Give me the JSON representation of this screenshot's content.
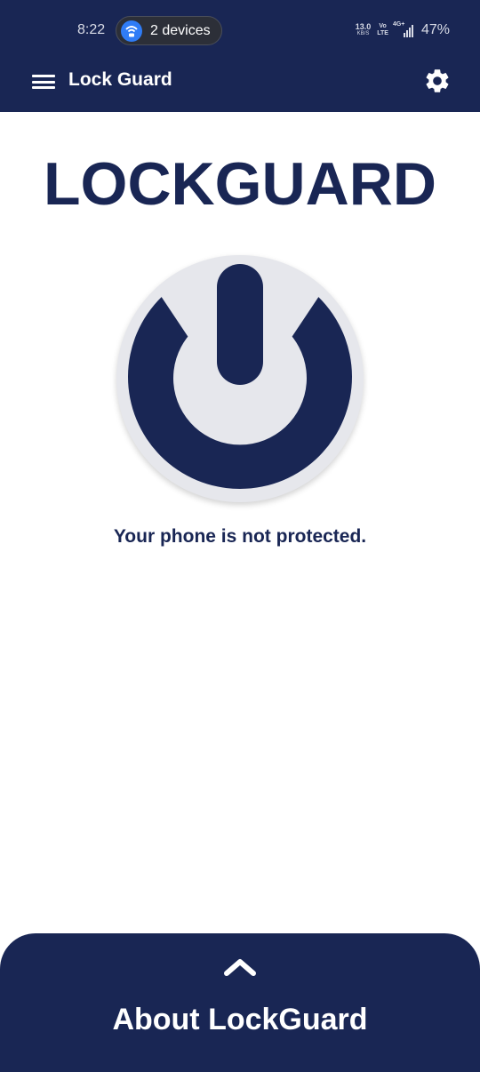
{
  "status_bar": {
    "time": "8:22",
    "hotspot_label": "2 devices",
    "net_speed_value": "13.0",
    "net_speed_unit": "KB/S",
    "volte_top": "Vo",
    "volte_bottom": "LTE",
    "signal_label": "4G+",
    "battery": "47%"
  },
  "app_bar": {
    "title": "Lock Guard"
  },
  "main": {
    "brand_title": "LOCKGUARD",
    "protection_status": "Your phone is not protected."
  },
  "about_panel": {
    "title": "About LockGuard"
  },
  "colors": {
    "primary": "#192654",
    "button_bg": "#e6e7ec",
    "hotspot_accent": "#2f7cf6"
  },
  "icons": {
    "menu": "menu-icon",
    "settings": "gear-icon",
    "power": "power-icon",
    "chevron": "chevron-up-icon",
    "hotspot": "wifi-hotspot-icon"
  }
}
